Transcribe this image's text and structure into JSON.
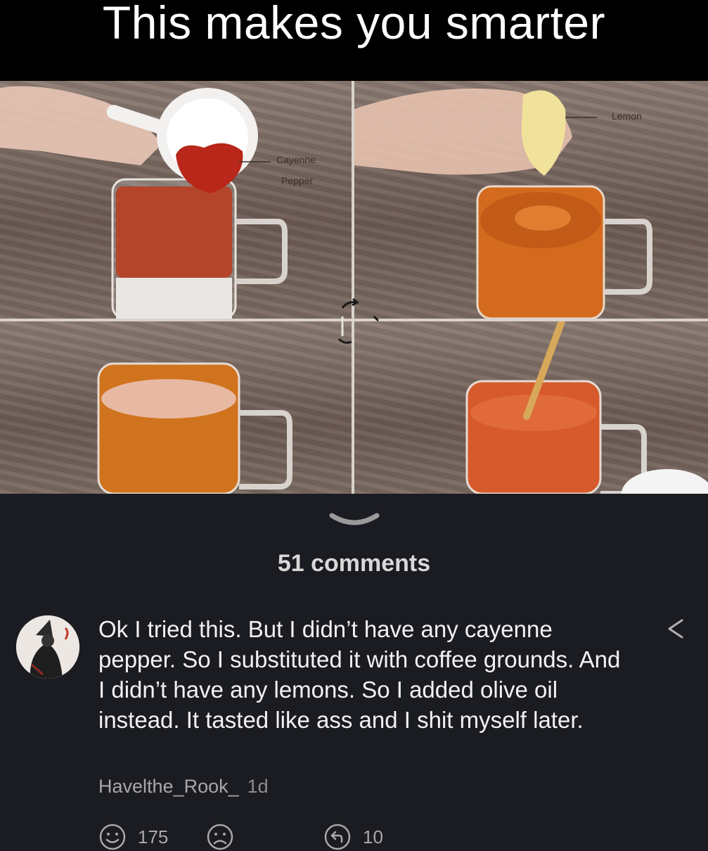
{
  "meme": {
    "title": "This makes you smarter",
    "labels": {
      "cayenne_line1": "Cayenne",
      "cayenne_line2": "Pepper",
      "lemon": "Lemon"
    }
  },
  "comments_section": {
    "count_label": "51 comments"
  },
  "comment": {
    "text": "Ok I tried this. But I didn’t have any cayenne pepper. So I substituted it with coffee grounds. And I didn’t have any lemons. So I added olive oil instead. It tasted like ass and I shit myself later.",
    "author": "Havelthe_Rook_",
    "age": "1d",
    "likes": "175",
    "replies": "10"
  },
  "icons": [
    "chevron-down-icon",
    "share-icon",
    "smile-icon",
    "frown-icon",
    "reply-icon",
    "cycle-arrows-icon"
  ],
  "colors": {
    "background": "#1b1c21",
    "header": "#000000",
    "text": "#f2f2f2",
    "muted": "#a8a8a8"
  }
}
